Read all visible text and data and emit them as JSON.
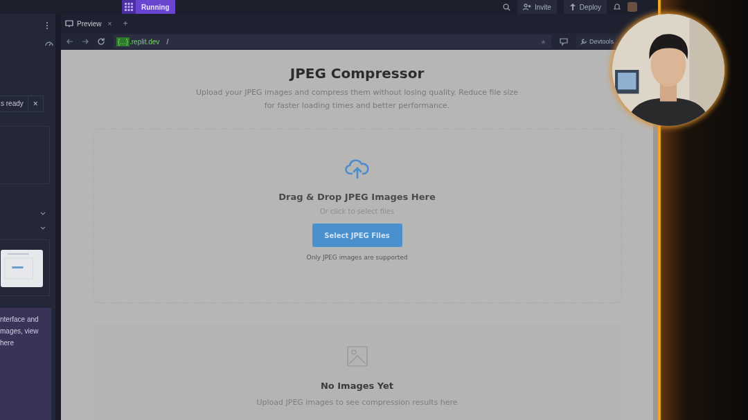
{
  "top_bar": {
    "status": "Running",
    "invite": "Invite",
    "deploy": "Deploy"
  },
  "left_panel": {
    "notice": "s ready",
    "notice_close": "×",
    "message_lines": [
      "nterface and",
      "mages, view",
      "here"
    ]
  },
  "preview_tab": {
    "label": "Preview",
    "close": "×",
    "add": "+"
  },
  "address_bar": {
    "host_badge": "{...}",
    "host": ".replit.dev",
    "path": "/",
    "devtools": "Devtools"
  },
  "app": {
    "title": "JPEG Compressor",
    "description": "Upload your JPEG images and compress them without losing quality. Reduce file size for faster loading times and better performance.",
    "dropzone": {
      "heading": "Drag & Drop JPEG Images Here",
      "subtext": "Or click to select files",
      "button": "Select JPEG Files",
      "note": "Only JPEG images are supported"
    },
    "results": {
      "heading": "No Images Yet",
      "subtext": "Upload JPEG images to see compression results here"
    }
  }
}
